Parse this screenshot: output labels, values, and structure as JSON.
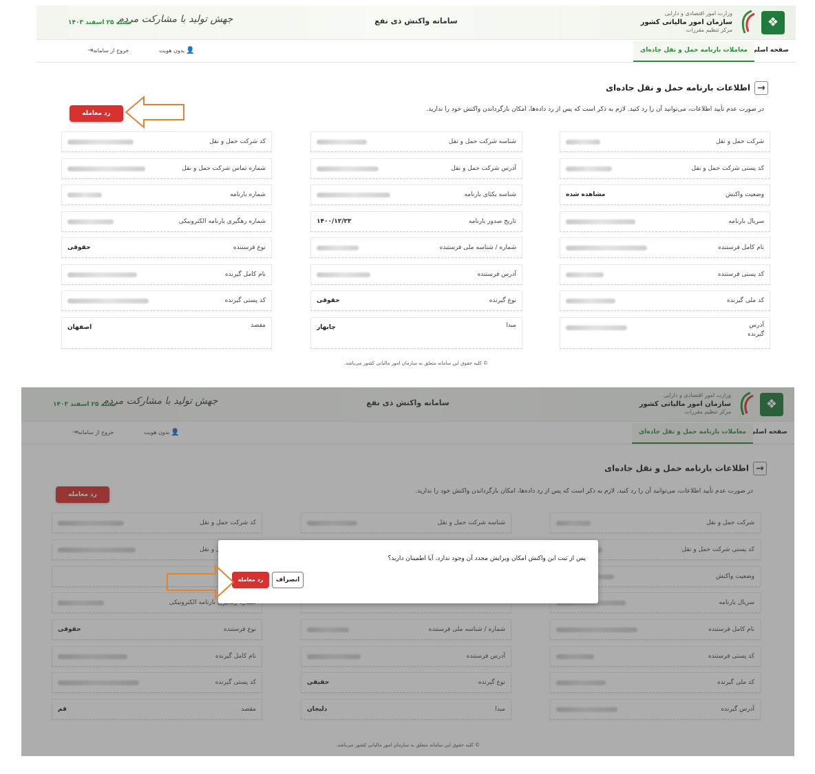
{
  "header": {
    "ministry": "وزارت امور اقتصادی و دارایی",
    "org_name": "سازمان امور مالیاتی کشور",
    "center": "مرکز تنظیم مقررات",
    "app_title": "سامانه واکنش ذی نفع",
    "slogan": "جهش تولید با مشارکت مردم",
    "date": "شنبه ۲۵ اسفند ۱۴۰۳"
  },
  "nav": {
    "home": "صفحه اصلی",
    "active_tab": "معاملات بارنامه حمل و نقل جاده‌ای",
    "no_identity": "بدون هویت",
    "exit": "خروج از سامانه"
  },
  "section": {
    "title": "اطلاعات بارنامه حمل و نقل جاده‌ای",
    "warning": "در صورت عدم تأیید اطلاعات، می‌توانید آن را رد کنید. لازم به ذکر است که پس از رد داده‌ها، امکان بازگرداندن واکنش خود را ندارید.",
    "reject_button": "رد معامله"
  },
  "fields_screen1": {
    "col_right": [
      {
        "label": "شرکت حمل و نقل",
        "value": ""
      },
      {
        "label": "کد پستی شرکت حمل و نقل",
        "value": ""
      },
      {
        "label": "وضعیت واکنش",
        "value": "مشاهده شده"
      },
      {
        "label": "سریال بارنامه",
        "value": ""
      },
      {
        "label": "نام کامل فرستنده",
        "value": ""
      },
      {
        "label": "کد پستی فرستنده",
        "value": ""
      },
      {
        "label": "کد ملی گیرنده",
        "value": ""
      },
      {
        "label": "آدرس گیرنده",
        "value": ""
      }
    ],
    "col_mid": [
      {
        "label": "شناسه شرکت حمل و نقل",
        "value": ""
      },
      {
        "label": "آدرس شرکت حمل و نقل",
        "value": ""
      },
      {
        "label": "شناسه یکتای بارنامه",
        "value": ""
      },
      {
        "label": "تاریخ صدور بارنامه",
        "value": "۱۴۰۰/۱۲/۲۳"
      },
      {
        "label": "شماره / شناسه ملی فرستنده",
        "value": ""
      },
      {
        "label": "آدرس فرستنده",
        "value": ""
      },
      {
        "label": "نوع گیرنده",
        "value": "حقوقی"
      },
      {
        "label": "مبدا",
        "value": "چابهار"
      }
    ],
    "col_left": [
      {
        "label": "کد شرکت حمل و نقل",
        "value": ""
      },
      {
        "label": "شماره تماس شرکت حمل و نقل",
        "value": ""
      },
      {
        "label": "شماره بارنامه",
        "value": ""
      },
      {
        "label": "شماره رهگیری بارنامه الکترونیکی",
        "value": ""
      },
      {
        "label": "نوع فرستنده",
        "value": "حقوقی"
      },
      {
        "label": "نام کامل گیرنده",
        "value": ""
      },
      {
        "label": "کد پستی گیرنده",
        "value": ""
      },
      {
        "label": "مقصد",
        "value": "اصفهان"
      }
    ]
  },
  "fields_screen2": {
    "col_right": [
      {
        "label": "شرکت حمل و نقل",
        "value": ""
      },
      {
        "label": "کد پستی شرکت حمل و نقل",
        "value": ""
      },
      {
        "label": "وضعیت واکنش",
        "value": ""
      },
      {
        "label": "سریال بارنامه",
        "value": ""
      },
      {
        "label": "نام کامل فرستنده",
        "value": ""
      },
      {
        "label": "کد پستی فرستنده",
        "value": ""
      },
      {
        "label": "کد ملی گیرنده",
        "value": ""
      },
      {
        "label": "آدرس گیرنده",
        "value": ""
      }
    ],
    "col_mid": [
      {
        "label": "شناسه شرکت حمل و نقل",
        "value": ""
      },
      {
        "label": "",
        "value": ""
      },
      {
        "label": "",
        "value": ""
      },
      {
        "label": "",
        "value": ""
      },
      {
        "label": "شماره / شناسه ملی فرستنده",
        "value": ""
      },
      {
        "label": "آدرس فرستنده",
        "value": ""
      },
      {
        "label": "نوع گیرنده",
        "value": "حقیقی"
      },
      {
        "label": "مبدا",
        "value": "دلیجان"
      }
    ],
    "col_left": [
      {
        "label": "کد شرکت حمل و نقل",
        "value": ""
      },
      {
        "label": "کد شرکت حمل و نقل",
        "value": ""
      },
      {
        "label": "",
        "value": ""
      },
      {
        "label": "شماره رهگیری بارنامه الکترونیکی",
        "value": ""
      },
      {
        "label": "نوع فرستنده",
        "value": "حقوقی"
      },
      {
        "label": "نام کامل گیرنده",
        "value": ""
      },
      {
        "label": "کد پستی گیرنده",
        "value": ""
      },
      {
        "label": "مقصد",
        "value": "قم"
      }
    ]
  },
  "dialog": {
    "message": "پس از ثبت این واکنش امکان ویرایش مجدد آن وجود ندارد، آیا اطمینان دارید؟",
    "cancel": "انصراف",
    "confirm": "رد معامله"
  },
  "footer": "© کلیه حقوق این سامانه متعلق به سازمان امور مالیاتی کشور می‌باشد.",
  "colors": {
    "accent_green": "#2e8b3a",
    "reject_red": "#d93030",
    "callout_orange": "#e8822a"
  },
  "icons": {
    "back": "arrow-right-icon",
    "user": "user-icon",
    "exit": "logout-icon",
    "emblem": "emblem-icon"
  }
}
